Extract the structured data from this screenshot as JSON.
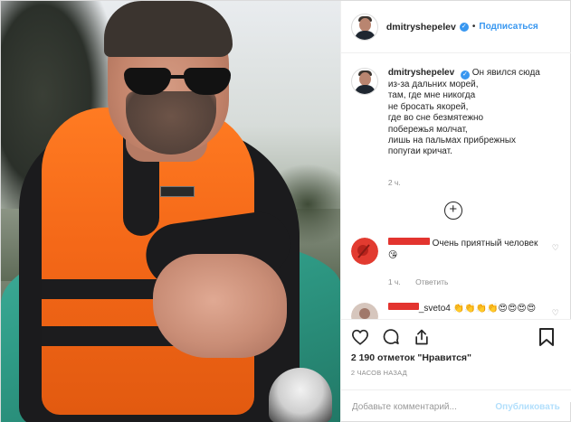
{
  "post": {
    "username": "dmitryshepelev",
    "verified_icon": "verified-badge-icon",
    "separator": "•",
    "follow_label": "Подписаться"
  },
  "caption": {
    "username": "dmitryshepelev",
    "lines": [
      "Он явился сюда",
      "из-за дальних морей,",
      "там, где мне никогда",
      "не бросать якорей,",
      "где во сне безмятежно",
      "побережья молчат,",
      "лишь на пальмах прибрежных",
      "попугаи кричат."
    ],
    "time": "2 ч."
  },
  "load_more_icon": "plus-circle-icon",
  "comments": [
    {
      "text": "Очень приятный человек",
      "emoji": "😘",
      "time": "1 ч.",
      "reply_label": "Ответить"
    },
    {
      "text": "_sveto4",
      "emoji": "👏👏👏👏😍😍😍😍"
    }
  ],
  "actions": {
    "icons": [
      "heart-icon",
      "comment-icon",
      "share-icon",
      "bookmark-icon"
    ],
    "likes": "2 190 отметок \"Нравится\"",
    "posted": "2 ЧАСОВ НАЗАД"
  },
  "add_comment": {
    "placeholder": "Добавьте комментарий...",
    "publish_label": "Опубликовать"
  },
  "colors": {
    "accent": "#3897f0",
    "publish_disabled": "#b2dffc",
    "redaction": "#e3342f",
    "vest": "#f46818",
    "boat": "#2f9b86"
  }
}
